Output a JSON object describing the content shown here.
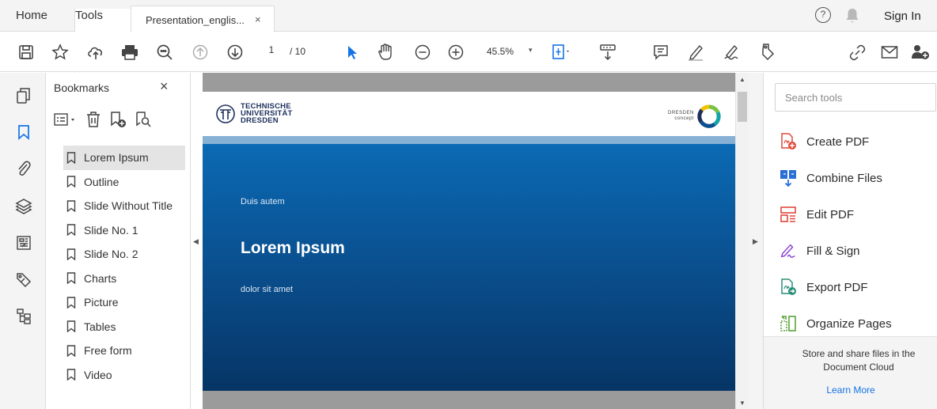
{
  "tabbar": {
    "home_label": "Home",
    "tools_label": "Tools",
    "doc_tab_title": "Presentation_englis...",
    "doc_tab_close": "×",
    "help_glyph": "?",
    "signin_label": "Sign In"
  },
  "toolbar": {
    "page_current": "1",
    "page_total": "/ 10",
    "zoom_value": "45.5%",
    "zoom_caret": "▾"
  },
  "bookmarks": {
    "title": "Bookmarks",
    "close": "×",
    "items": [
      {
        "label": "Lorem Ipsum",
        "selected": true
      },
      {
        "label": "Outline"
      },
      {
        "label": "Slide Without Title"
      },
      {
        "label": "Slide No. 1"
      },
      {
        "label": "Slide No. 2"
      },
      {
        "label": "Charts"
      },
      {
        "label": "Picture"
      },
      {
        "label": "Tables"
      },
      {
        "label": "Free form"
      },
      {
        "label": "Video"
      }
    ]
  },
  "slide": {
    "logo_line1": "TECHNISCHE",
    "logo_line2": "UNIVERSITÄT",
    "logo_line3": "DRESDEN",
    "concept_line1": "DRESDEN",
    "concept_line2": "concept",
    "kicker": "Duis autem",
    "title": "Lorem Ipsum",
    "subtitle": "dolor sit amet"
  },
  "tools_pane": {
    "search_placeholder": "Search tools",
    "tools": [
      {
        "label": "Create PDF",
        "icon": "create-pdf-icon",
        "color": "#e0493b"
      },
      {
        "label": "Combine Files",
        "icon": "combine-files-icon",
        "color": "#2a6fd6"
      },
      {
        "label": "Edit PDF",
        "icon": "edit-pdf-icon",
        "color": "#e0493b"
      },
      {
        "label": "Fill & Sign",
        "icon": "fill-sign-icon",
        "color": "#8c45d1"
      },
      {
        "label": "Export PDF",
        "icon": "export-pdf-icon",
        "color": "#2a8f7a"
      },
      {
        "label": "Organize Pages",
        "icon": "organize-pages-icon",
        "color": "#5aa33c"
      }
    ],
    "cloud_text": "Store and share files in the Document Cloud",
    "cloud_link": "Learn More"
  },
  "colors": {
    "accent": "#1473e6",
    "slide_blue": "#0a4f8e",
    "slide_stripe": "#86b0d4"
  }
}
